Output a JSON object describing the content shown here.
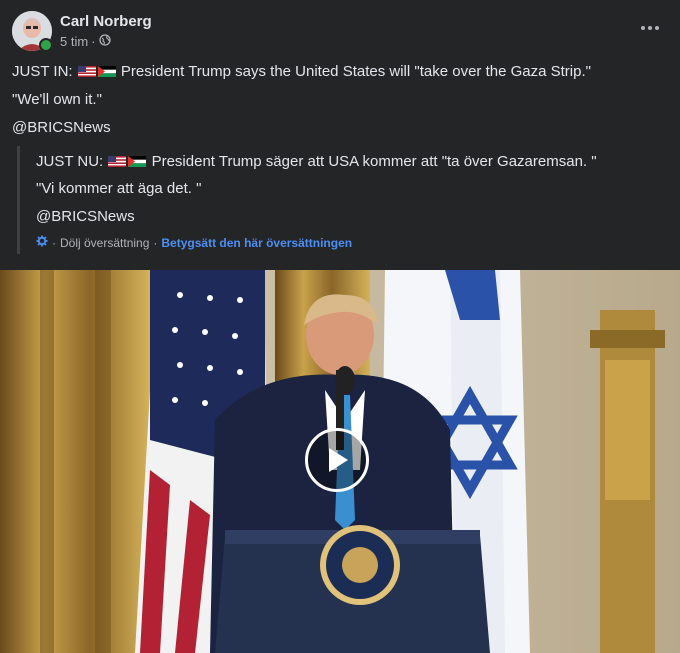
{
  "author": {
    "name": "Carl Norberg",
    "time": "5 tim",
    "separator": "·"
  },
  "post": {
    "line1_prefix": "JUST IN:",
    "line1_text": "President Trump says the United States will \"take over the Gaza Strip.\"",
    "line2": "\"We'll own it.\"",
    "line3": "@BRICSNews"
  },
  "translation": {
    "line1_prefix": "JUST NU:",
    "line1_text": "President Trump säger att USA kommer att \"ta över Gazaremsan. \"",
    "line2": "\"Vi kommer att äga det. \"",
    "line3": "@BRICSNews",
    "hide_label": "Dölj översättning",
    "rate_label": "Betygsätt den här översättningen",
    "dot": "·"
  },
  "icons": {
    "globe": "globe-icon",
    "more": "more-options-icon",
    "gear": "gear-icon",
    "play": "play-icon"
  },
  "colors": {
    "background": "#242526",
    "link": "#4b8ff7",
    "online": "#31a24c",
    "muted": "#b0b3b8"
  }
}
